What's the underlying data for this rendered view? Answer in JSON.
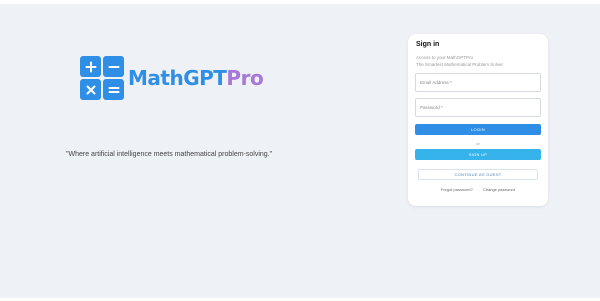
{
  "brand": {
    "name_main": "MathGPT",
    "name_suffix": "Pro",
    "tagline": "\"Where artificial intelligence meets mathematical problem-solving.\"",
    "icon_names": [
      "plus-icon",
      "minus-icon",
      "times-icon",
      "equals-icon"
    ],
    "colors": {
      "blue": "#2f8fe6",
      "purple": "#a878d8"
    }
  },
  "signin": {
    "title": "Sign in",
    "subtitle_line1": "Access to your MathGPTPro",
    "subtitle_line2": "The Smartest Mathematical Problem Solver",
    "email_placeholder": "Email Address *",
    "password_placeholder": "Password *",
    "login_label": "LOGIN",
    "or_label": "or",
    "signup_label": "SIGN UP",
    "guest_label": "CONTINUE AS GUEST",
    "forgot_label": "Forgot password?",
    "change_label": "Change password",
    "colors": {
      "login": "#2f8fe6",
      "signup": "#35b3ea"
    }
  }
}
